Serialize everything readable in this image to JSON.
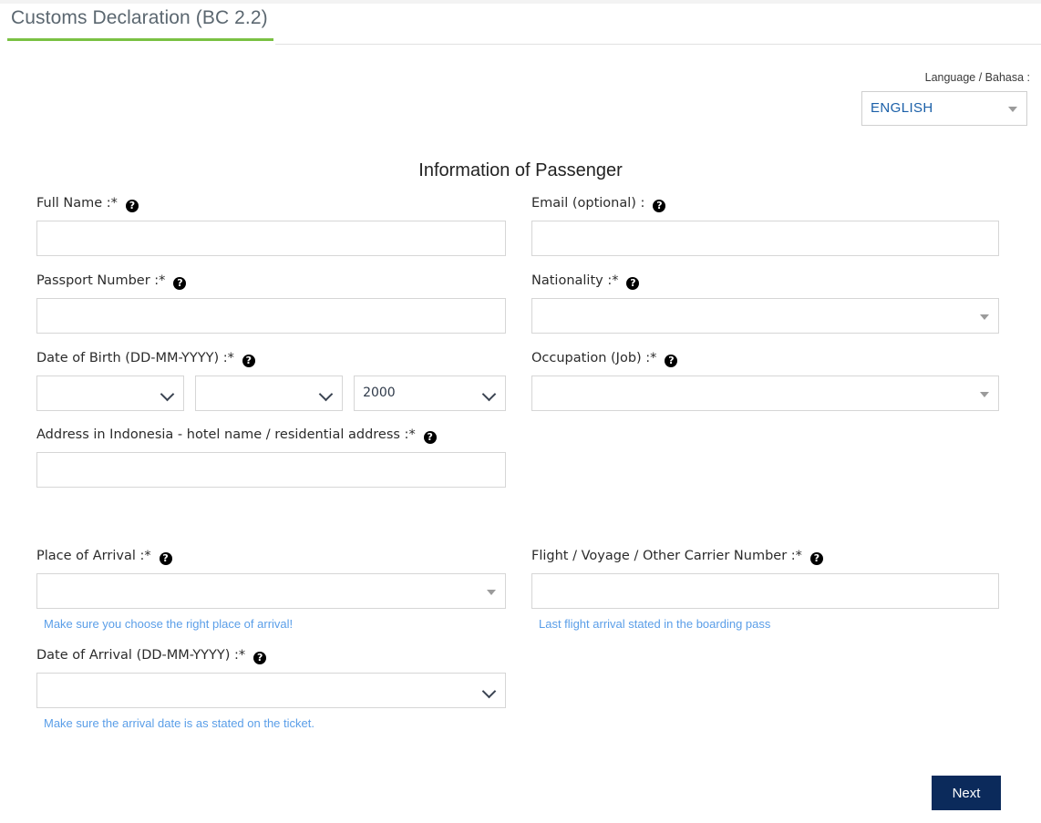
{
  "tab": {
    "title": "Customs Declaration (BC 2.2)",
    "accent_color": "#7ac143"
  },
  "language": {
    "label": "Language / Bahasa :",
    "selected": "ENGLISH",
    "caret_icon": "caret-down-icon"
  },
  "heading": "Information of Passenger",
  "help_icon_glyph": "?",
  "fields": {
    "full_name": {
      "label": "Full Name :*",
      "value": "",
      "placeholder": ""
    },
    "email": {
      "label": "Email (optional) :",
      "value": "",
      "placeholder": ""
    },
    "passport_number": {
      "label": "Passport Number :*",
      "value": "",
      "placeholder": ""
    },
    "nationality": {
      "label": "Nationality :*",
      "selected": ""
    },
    "date_of_birth": {
      "label": "Date of Birth (DD-MM-YYYY) :*",
      "day": "",
      "month": "",
      "year": "2000"
    },
    "occupation": {
      "label": "Occupation (Job) :*",
      "selected": ""
    },
    "address": {
      "label": "Address in Indonesia - hotel name / residential address :*",
      "value": "",
      "placeholder": ""
    },
    "place_of_arrival": {
      "label": "Place of Arrival :*",
      "selected": "",
      "hint": "Make sure you choose the right place of arrival!"
    },
    "flight_number": {
      "label": "Flight / Voyage / Other Carrier Number :*",
      "value": "",
      "placeholder": "",
      "hint": "Last flight arrival stated in the boarding pass"
    },
    "date_of_arrival": {
      "label": "Date of Arrival (DD-MM-YYYY) :*",
      "selected": "",
      "hint": "Make sure the arrival date is as stated on the ticket."
    }
  },
  "actions": {
    "next_label": "Next",
    "next_color": "#0b2a5b"
  }
}
